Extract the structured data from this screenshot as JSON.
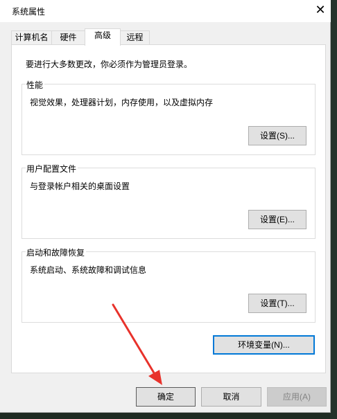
{
  "window": {
    "title": "系统属性",
    "close_glyph": "✕"
  },
  "tabs": [
    {
      "label": "计算机名",
      "active": false
    },
    {
      "label": "硬件",
      "active": false
    },
    {
      "label": "高级",
      "active": true
    },
    {
      "label": "远程",
      "active": false
    }
  ],
  "notice": "要进行大多数更改，你必须作为管理员登录。",
  "performance": {
    "label": "性能",
    "description": "视觉效果，处理器计划，内存使用，以及虚拟内存",
    "button": "设置(S)..."
  },
  "user_profiles": {
    "label": "用户配置文件",
    "description": "与登录帐户相关的桌面设置",
    "button": "设置(E)..."
  },
  "startup_recovery": {
    "label": "启动和故障恢复",
    "description": "系统启动、系统故障和调试信息",
    "button": "设置(T)..."
  },
  "env_button": "环境变量(N)...",
  "footer": {
    "ok": "确定",
    "cancel": "取消",
    "apply": "应用(A)"
  },
  "annotation": {
    "arrow_color": "#e8322b"
  },
  "colors": {
    "focus": "#0078d7",
    "dialog_bg": "#f0f0f0"
  }
}
